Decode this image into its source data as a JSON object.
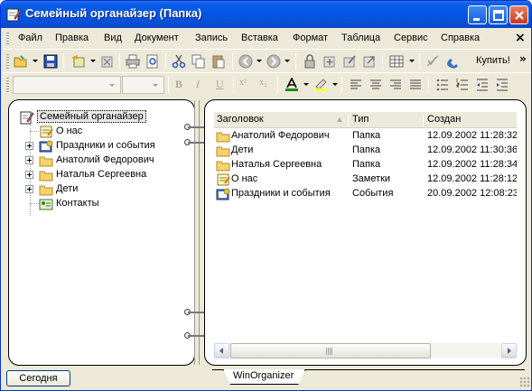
{
  "window": {
    "title": "Семейный органайзер (Папка)"
  },
  "menu": [
    "Файл",
    "Правка",
    "Вид",
    "Документ",
    "Запись",
    "Вставка",
    "Формат",
    "Таблица",
    "Сервис",
    "Справка"
  ],
  "toolbar": {
    "buy_label": "Купить!"
  },
  "tree": {
    "root": "Семейный органайзер",
    "items": [
      {
        "label": "О нас",
        "icon": "note-icon",
        "expandable": false
      },
      {
        "label": "Праздники и события",
        "icon": "events-icon",
        "expandable": true
      },
      {
        "label": "Анатолий Федорович",
        "icon": "folder-icon",
        "expandable": true
      },
      {
        "label": "Наталья Сергеевна",
        "icon": "folder-icon",
        "expandable": true
      },
      {
        "label": "Дети",
        "icon": "folder-icon",
        "expandable": true
      },
      {
        "label": "Контакты",
        "icon": "contacts-icon",
        "expandable": false
      }
    ]
  },
  "list": {
    "columns": [
      "Заголовок",
      "Тип",
      "Создан"
    ],
    "rows": [
      {
        "title": "Анатолий Федорович",
        "type": "Папка",
        "created": "12.09.2002 11:28:32",
        "icon": "folder-icon"
      },
      {
        "title": "Дети",
        "type": "Папка",
        "created": "12.09.2002 11:30:36",
        "icon": "folder-icon"
      },
      {
        "title": "Наталья Сергеевна",
        "type": "Папка",
        "created": "12.09.2002 11:28:34",
        "icon": "folder-icon"
      },
      {
        "title": "О нас",
        "type": "Заметки",
        "created": "12.09.2002 11:28:12",
        "icon": "note-icon"
      },
      {
        "title": "Праздники и события",
        "type": "События",
        "created": "20.09.2002 12:08:23",
        "icon": "events-icon"
      }
    ]
  },
  "bottom": {
    "today_label": "Сегодня",
    "tab_label": "WinOrganizer"
  },
  "colors": {
    "titlebar": "#0455e6",
    "face": "#ece9d8",
    "folder": "#f6d36b"
  }
}
